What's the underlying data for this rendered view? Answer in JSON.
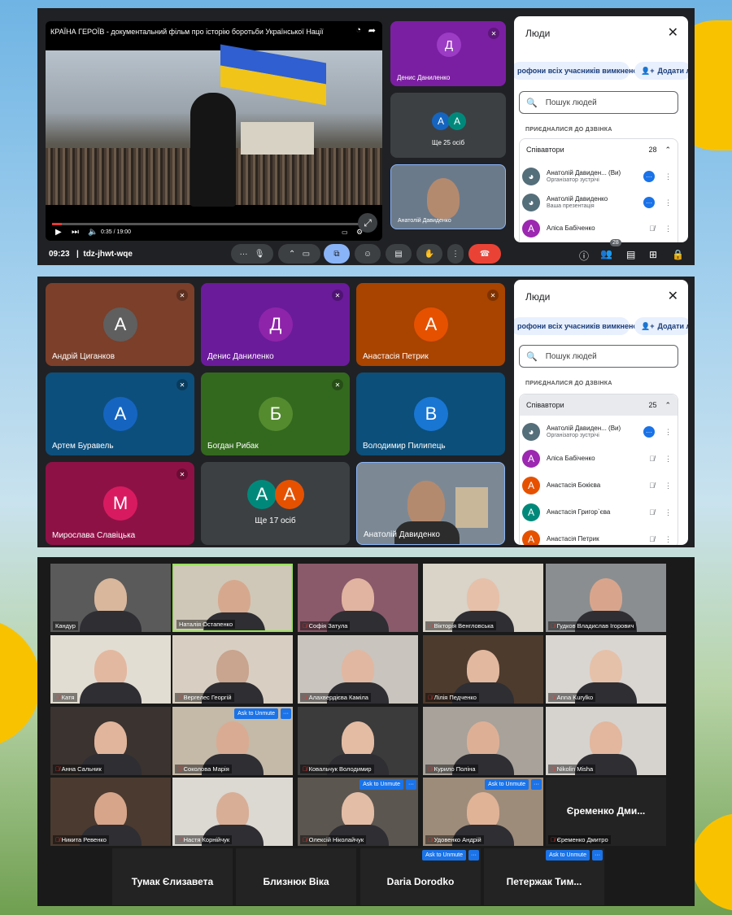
{
  "meet1": {
    "video_title": "КРАЇНА ГЕРОЇВ - документальний фільм про історію боротьби Української Нації",
    "video_time": "0:35 / 19:00",
    "clock": "09:23",
    "meeting_code": "tdz-jhwt-wqe",
    "tiles": [
      {
        "letter": "Д",
        "name": "Денис Даниленко",
        "color": "#7b1fa2"
      },
      {
        "letters": [
          "А",
          "А"
        ],
        "name": "Ще 25 осіб"
      },
      {
        "name": "Анатолій Давиденко"
      }
    ],
    "people_count_badge": "28",
    "sidebar": {
      "title": "Люди",
      "mute_all_pill": "рофони всіх учасників вимкнено",
      "add_pill": "Додати л",
      "search_placeholder": "Пошук людей",
      "section": "ПРИЄДНАЛИСЯ ДО ДЗВІНКА",
      "group": "Співавтори",
      "group_count": "28",
      "people": [
        {
          "name": "Анатолій Давиден...",
          "tag": "(Ви)",
          "sub": "Організатор зустрічі"
        },
        {
          "name": "Анатолій Давиденко",
          "tag": "",
          "sub": "Ваша презентація"
        },
        {
          "name": "Аліса Бабіченко",
          "tag": "",
          "sub": "",
          "letter": "А",
          "color": "#9c27b0"
        }
      ]
    }
  },
  "meet2": {
    "tiles": [
      {
        "letter": "А",
        "name": "Андрій Циганков",
        "bg": "#7b3f2a",
        "avbg": "#5f5f5f"
      },
      {
        "letter": "Д",
        "name": "Денис Даниленко",
        "bg": "#6a1b9a",
        "avbg": "#8e24aa"
      },
      {
        "letter": "А",
        "name": "Анастасія Петрик",
        "bg": "#a84300",
        "avbg": "#e65100"
      },
      {
        "letter": "А",
        "name": "Артем Буравель",
        "bg": "#0d4f7c",
        "avbg": "#1565c0"
      },
      {
        "letter": "Б",
        "name": "Богдан Рибак",
        "bg": "#33691e",
        "avbg": "#558b2f"
      },
      {
        "letter": "В",
        "name": "Володимир Пилипець",
        "bg": "#0b4f7a",
        "avbg": "#1976d2"
      },
      {
        "letter": "М",
        "name": "Мирослава Славіцька",
        "bg": "#8e1146",
        "avbg": "#d81b60"
      },
      {
        "letters": [
          "А",
          "А"
        ],
        "name": "Ще 17 осіб"
      },
      {
        "name": "Анатолій Давиденко"
      }
    ],
    "sidebar": {
      "title": "Люди",
      "mute_all_pill": "рофони всіх учасників вимкнено",
      "add_pill": "Додати л",
      "search_placeholder": "Пошук людей",
      "section": "ПРИЄДНАЛИСЯ ДО ДЗВІНКА",
      "group": "Співавтори",
      "group_count": "25",
      "people": [
        {
          "name": "Анатолій Давиден...",
          "tag": "(Ви)",
          "sub": "Організатор зустрічі"
        },
        {
          "name": "Аліса Бабіченко",
          "letter": "А",
          "color": "#9c27b0"
        },
        {
          "name": "Анастасія Бокієва",
          "letter": "А",
          "color": "#e65100"
        },
        {
          "name": "Анастасія Григор`єва",
          "letter": "А",
          "color": "#00897b"
        },
        {
          "name": "Анастасія Петрик",
          "letter": "А",
          "color": "#e65100"
        }
      ]
    }
  },
  "zoom": {
    "rows": [
      [
        {
          "name": "Кандур",
          "muted": false
        },
        {
          "name": "Наталія Остапенко",
          "muted": false,
          "active": true
        },
        {
          "name": "Софія Затула",
          "muted": true
        },
        {
          "name": "Вікторія Венгловська",
          "muted": true
        },
        {
          "name": "Гудков Владислав Ігорович",
          "muted": true
        }
      ],
      [
        {
          "name": "Катя",
          "muted": true
        },
        {
          "name": "Вергелес Георгій",
          "muted": true
        },
        {
          "name": "Алахвердієва Каміла",
          "muted": true
        },
        {
          "name": "Лілія Педченко",
          "muted": true
        },
        {
          "name": "Anna Kurylko",
          "muted": true
        }
      ],
      [
        {
          "name": "Анна Сальник",
          "muted": true
        },
        {
          "name": "Соколова Марія",
          "muted": true,
          "unmute": true
        },
        {
          "name": "Ковальчук Володимир",
          "muted": true
        },
        {
          "name": "Курило Поліна",
          "muted": true
        },
        {
          "name": "Nikolin Misha",
          "muted": true
        }
      ],
      [
        {
          "name": "Никита Ревенко",
          "muted": true
        },
        {
          "name": "Настя Корнійчук",
          "muted": true
        },
        {
          "name": "Олексій Ніколайчук",
          "muted": true,
          "unmute": true
        },
        {
          "name": "Удовенко Андрій",
          "muted": true,
          "unmute": true
        },
        {
          "name": "Єременко Дмитро",
          "muted": true,
          "big": "Єременко Дми..."
        }
      ]
    ],
    "bottom": [
      {
        "big": "Тумак Єлизавета"
      },
      {
        "big": "Близнюк Віка"
      },
      {
        "big": "Daria Dorodko",
        "unmute": true
      },
      {
        "big": "Петержак Тим...",
        "unmute": true
      }
    ],
    "ask_to_unmute": "Ask to Unmute",
    "more": "···"
  }
}
